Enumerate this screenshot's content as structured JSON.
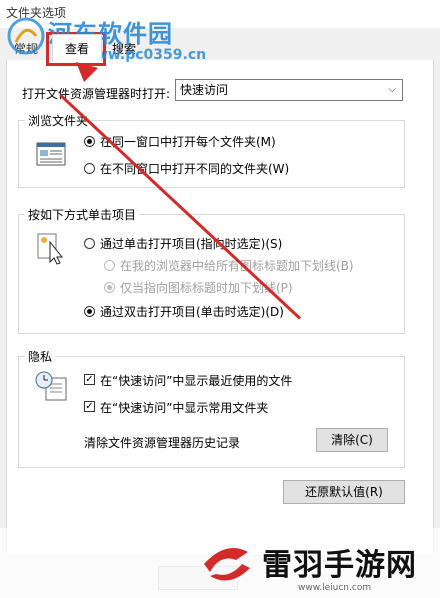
{
  "window": {
    "title": "文件夹选项"
  },
  "tabs": {
    "general": "常规",
    "view": "查看",
    "search": "搜索"
  },
  "open_explorer": {
    "label": "打开文件资源管理器时打开:",
    "value": "快速访问"
  },
  "browse_folders": {
    "title": "浏览文件夹",
    "options": [
      "在同一窗口中打开每个文件夹(M)",
      "在不同窗口中打开不同的文件夹(W)"
    ],
    "selected_index": 0
  },
  "click_items": {
    "title": "按如下方式单击项目",
    "single_click": "通过单击打开项目(指向时选定)(S)",
    "underline_all": "在我的浏览器中给所有图标标题加下划线(B)",
    "underline_point": "仅当指向图标标题时加下划线(P)",
    "double_click": "通过双击打开项目(单击时选定)(D)"
  },
  "privacy": {
    "title": "隐私",
    "recent_files": "在“快速访问”中显示最近使用的文件",
    "frequent_folders": "在“快速访问”中显示常用文件夹",
    "clear_label": "清除文件资源管理器历史记录",
    "clear_button": "清除(C)"
  },
  "restore_button": "还原默认值(R)",
  "watermark": {
    "top_text": "河东软件园",
    "top_url": "www.pc0359.cn",
    "bottom_text": "雷羽手游网",
    "bottom_url": "www.leiucn.com"
  },
  "colors": {
    "highlight": "#d42a2a",
    "watermark_blue": "#2a8ad8"
  }
}
